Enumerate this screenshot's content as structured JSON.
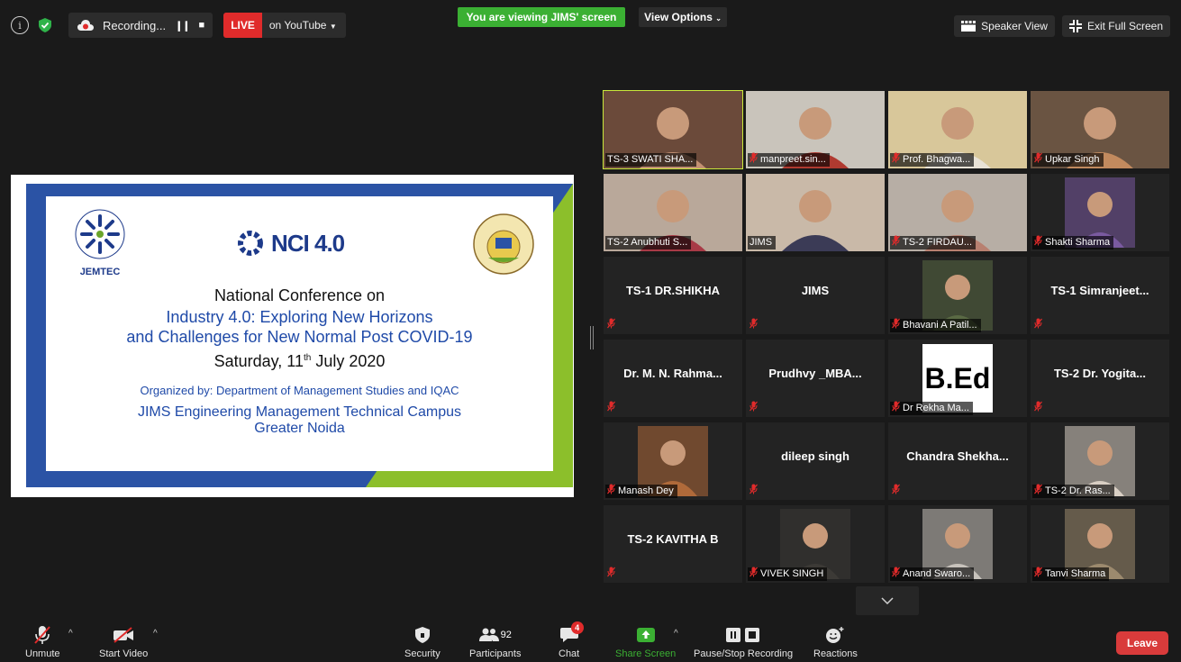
{
  "topbar": {
    "recording_label": "Recording...",
    "live_badge": "LIVE",
    "live_target": "on YouTube",
    "viewing_banner": "You are viewing JIMS' screen",
    "view_options": "View Options",
    "speaker_view": "Speaker View",
    "exit_full_screen": "Exit Full Screen"
  },
  "slide": {
    "jemtec": "JEMTEC",
    "nci": "NCI 4.0",
    "line1": "National Conference on",
    "line2": "Industry 4.0: Exploring New Horizons",
    "line3": "and Challenges for New Normal Post COVID-19",
    "line4_pre": "Saturday, 11",
    "line4_sup": "th",
    "line4_post": " July 2020",
    "line5": "Organized by: Department of Management Studies and IQAC",
    "line6": "JIMS Engineering Management Technical Campus",
    "line7": "Greater Noida"
  },
  "participants": [
    {
      "name": "TS-3 SWATI SHA...",
      "video": true,
      "bg": "#6b4a3a",
      "fg": "#c29072",
      "mic": false,
      "active": true
    },
    {
      "name": "manpreet.sin...",
      "video": true,
      "bg": "#c9c4bb",
      "fg": "#b03a30",
      "mic": true
    },
    {
      "name": "Prof. Bhagwa...",
      "video": true,
      "bg": "#d8c79a",
      "fg": "#e8e2d6",
      "mic": true
    },
    {
      "name": "Upkar Singh",
      "video": true,
      "bg": "#6a5442",
      "fg": "#c28a5e",
      "mic": true
    },
    {
      "name": "TS-2 Anubhuti S...",
      "video": true,
      "bg": "#b9a89a",
      "fg": "#a83a46",
      "mic": false
    },
    {
      "name": "JIMS",
      "video": true,
      "bg": "#c9b9a8",
      "fg": "#3b3b56",
      "mic": false
    },
    {
      "name": "TS-2 FIRDAU...",
      "video": true,
      "bg": "#b7aea5",
      "fg": "#b88070",
      "mic": true
    },
    {
      "name": "Shakti Sharma",
      "video": true,
      "bg": "#24242e",
      "fg": "#7a5aa0",
      "mic": true,
      "small": true
    },
    {
      "name": "TS-1 DR.SHIKHA",
      "video": false,
      "mic": true
    },
    {
      "name": "JIMS",
      "video": false,
      "mic": true
    },
    {
      "name": "Bhavani A Patil...",
      "video": true,
      "bg": "#232323",
      "fg": "#5a6a44",
      "mic": true,
      "small": true
    },
    {
      "name": "TS-1 Simranjeet...",
      "video": false,
      "mic": true
    },
    {
      "name": "Dr. M. N. Rahma...",
      "video": false,
      "mic": true
    },
    {
      "name": "Prudhvy _MBA...",
      "video": false,
      "mic": true
    },
    {
      "name": "Dr Rekha Ma...",
      "video": true,
      "mic": true,
      "bed": "B.Ed"
    },
    {
      "name": "TS-2 Dr. Yogita...",
      "video": false,
      "mic": true
    },
    {
      "name": "Manash Dey",
      "video": true,
      "bg": "#232323",
      "fg": "#b06a3a",
      "mic": true,
      "small": true
    },
    {
      "name": "dileep singh",
      "video": false,
      "mic": true
    },
    {
      "name": "Chandra  Shekha...",
      "video": false,
      "mic": true
    },
    {
      "name": "TS-2 Dr. Ras...",
      "video": true,
      "bg": "#232323",
      "fg": "#d9cfc4",
      "mic": true,
      "small": true
    },
    {
      "name": "TS-2 KAVITHA B",
      "video": false,
      "mic": true
    },
    {
      "name": "VIVEK SINGH",
      "video": true,
      "bg": "#232323",
      "fg": "#3c3a36",
      "mic": true,
      "small": true
    },
    {
      "name": "Anand Swaro...",
      "video": true,
      "bg": "#232323",
      "fg": "#c8c3bc",
      "mic": true,
      "small": true
    },
    {
      "name": "Tanvi Sharma",
      "video": true,
      "bg": "#232323",
      "fg": "#9c8a6e",
      "mic": true,
      "small": true
    }
  ],
  "toolbar": {
    "unmute": "Unmute",
    "start_video": "Start Video",
    "security": "Security",
    "participants": "Participants",
    "participants_count": "92",
    "chat": "Chat",
    "chat_badge": "4",
    "share_screen": "Share Screen",
    "pause_stop": "Pause/Stop Recording",
    "reactions": "Reactions",
    "leave": "Leave"
  },
  "colors": {
    "share_screen_green": "#3bb033",
    "live_red": "#e02b2b",
    "active_speaker": "#c9e83b",
    "slide_blue": "#2b53a5",
    "slide_green": "#8cbf2b"
  }
}
